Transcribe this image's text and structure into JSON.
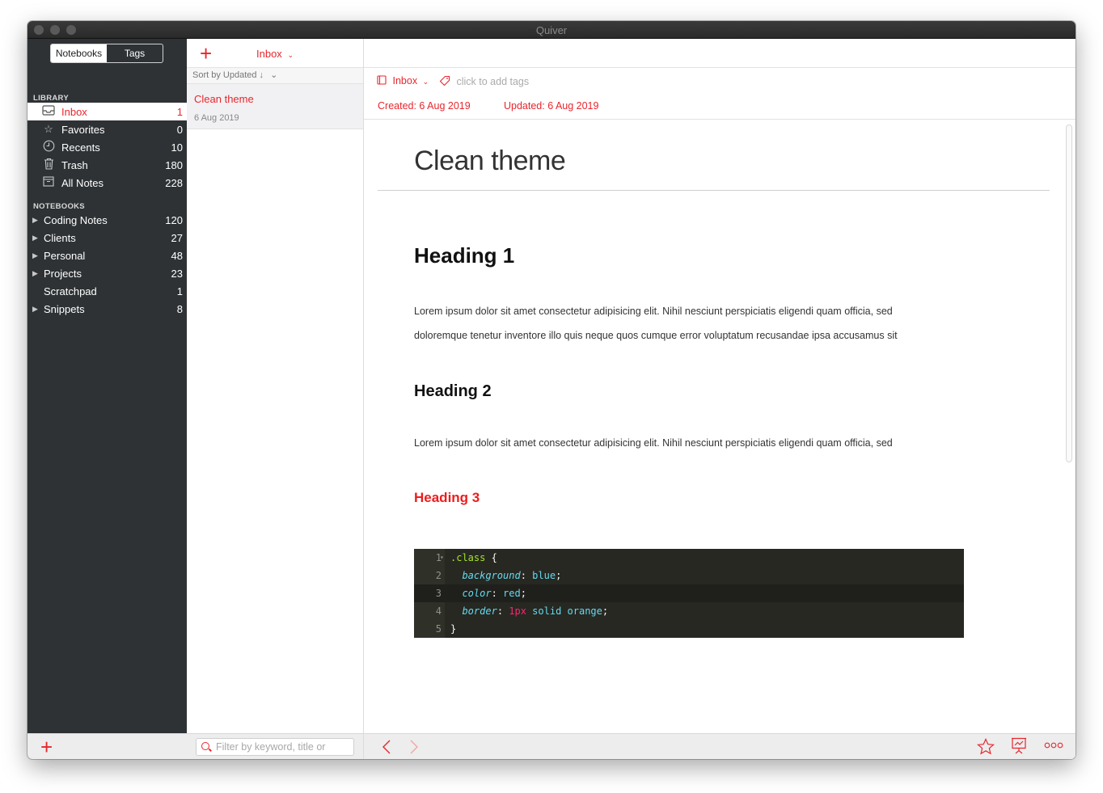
{
  "window": {
    "title": "Quiver"
  },
  "sidebar": {
    "tabs": [
      {
        "label": "Notebooks",
        "selected": true
      },
      {
        "label": "Tags",
        "selected": false
      }
    ],
    "library_header": "LIBRARY",
    "library": [
      {
        "label": "Inbox",
        "count": "1",
        "icon": "inbox-icon"
      },
      {
        "label": "Favorites",
        "count": "0",
        "icon": "star-icon"
      },
      {
        "label": "Recents",
        "count": "10",
        "icon": "clock-icon"
      },
      {
        "label": "Trash",
        "count": "180",
        "icon": "trash-icon"
      },
      {
        "label": "All Notes",
        "count": "228",
        "icon": "archive-icon"
      }
    ],
    "notebooks_header": "NOTEBOOKS",
    "notebooks": [
      {
        "label": "Coding Notes",
        "count": "120",
        "expandable": true
      },
      {
        "label": "Clients",
        "count": "27",
        "expandable": true
      },
      {
        "label": "Personal",
        "count": "48",
        "expandable": true
      },
      {
        "label": "Projects",
        "count": "23",
        "expandable": true
      },
      {
        "label": "Scratchpad",
        "count": "1",
        "expandable": false
      },
      {
        "label": "Snippets",
        "count": "8",
        "expandable": true
      }
    ]
  },
  "notelist": {
    "notebook_label": "Inbox",
    "sort_label": "Sort by Updated ↓",
    "notes": [
      {
        "title": "Clean theme",
        "date": "6 Aug 2019"
      }
    ],
    "filter_placeholder": "Filter by keyword, title or"
  },
  "editor": {
    "notebook_label": "Inbox",
    "tags_placeholder": "click to add tags",
    "created": "Created: 6 Aug 2019",
    "updated": "Updated: 6 Aug 2019",
    "title": "Clean theme",
    "heading1": "Heading 1",
    "para1_line1": "Lorem ipsum dolor sit amet consectetur adipisicing elit. Nihil nesciunt perspiciatis eligendi quam officia, sed",
    "para1_line2": "doloremque tenetur inventore illo quis neque quos cumque error voluptatum recusandae ipsa accusamus sit",
    "heading2": "Heading 2",
    "para2": "Lorem ipsum dolor sit amet consectetur adipisicing elit. Nihil nesciunt perspiciatis eligendi quam officia, sed",
    "heading3": "Heading 3",
    "code": {
      "line_numbers": [
        "1",
        "2",
        "3",
        "4",
        "5"
      ],
      "l1_selector": ".class",
      "l1_brace": " {",
      "l2_prop": "background",
      "l2_val": "blue",
      "l3_prop": "color",
      "l3_val": "red",
      "l4_prop": "border",
      "l4_num": "1",
      "l4_unit": "px",
      "l4_rest": " solid orange",
      "l5": "}"
    }
  },
  "colors": {
    "accent": "#e8262d",
    "sidebar_bg": "#2e3235",
    "code_bg": "#272822"
  }
}
